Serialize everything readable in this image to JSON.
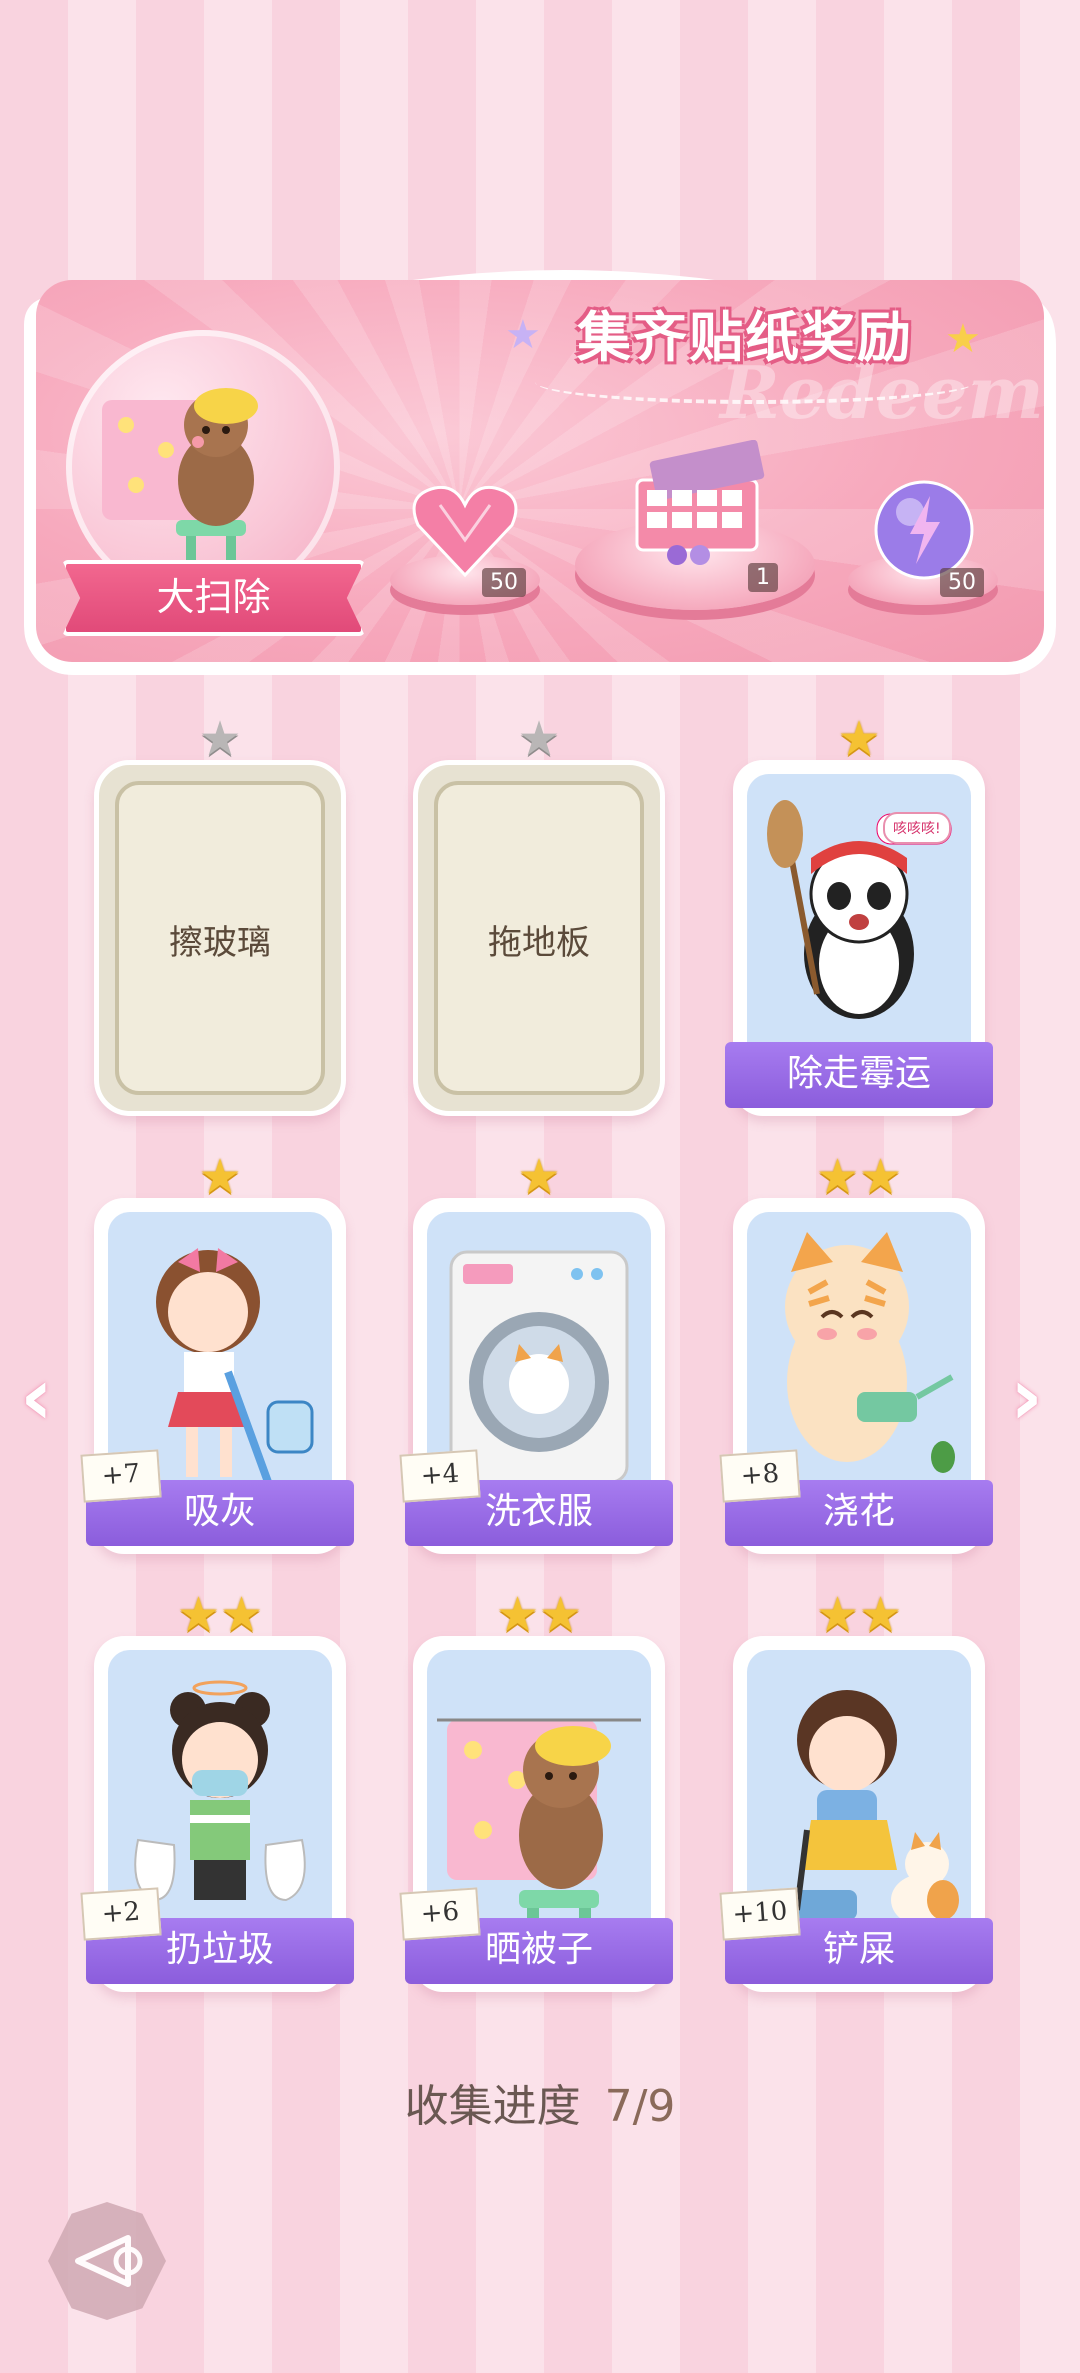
{
  "reward": {
    "title": "集齐贴纸奖励",
    "watermark": "Redeem",
    "set_name": "大扫除",
    "items": [
      {
        "name": "heart-gem",
        "count": "50"
      },
      {
        "name": "sticker-box",
        "count": "1"
      },
      {
        "name": "energy-orb",
        "count": "50"
      }
    ]
  },
  "cards": [
    {
      "label": "擦玻璃",
      "stars": 1,
      "collected": false,
      "bonus": ""
    },
    {
      "label": "拖地板",
      "stars": 1,
      "collected": false,
      "bonus": ""
    },
    {
      "label": "除走霉运",
      "stars": 1,
      "collected": true,
      "bonus": "",
      "speech": "咳咳咳!"
    },
    {
      "label": "吸灰",
      "stars": 1,
      "collected": true,
      "bonus": "+7"
    },
    {
      "label": "洗衣服",
      "stars": 1,
      "collected": true,
      "bonus": "+4"
    },
    {
      "label": "浇花",
      "stars": 2,
      "collected": true,
      "bonus": "+8"
    },
    {
      "label": "扔垃圾",
      "stars": 2,
      "collected": true,
      "bonus": "+2"
    },
    {
      "label": "晒被子",
      "stars": 2,
      "collected": true,
      "bonus": "+6"
    },
    {
      "label": "铲屎",
      "stars": 2,
      "collected": true,
      "bonus": "+10"
    }
  ],
  "progress": {
    "label": "收集进度",
    "value": "7/9"
  },
  "colors": {
    "accent_pink": "#e45d86",
    "name_bar": "#9466e2",
    "star_gold": "#f5c233",
    "star_grey": "#b9b6b6"
  }
}
